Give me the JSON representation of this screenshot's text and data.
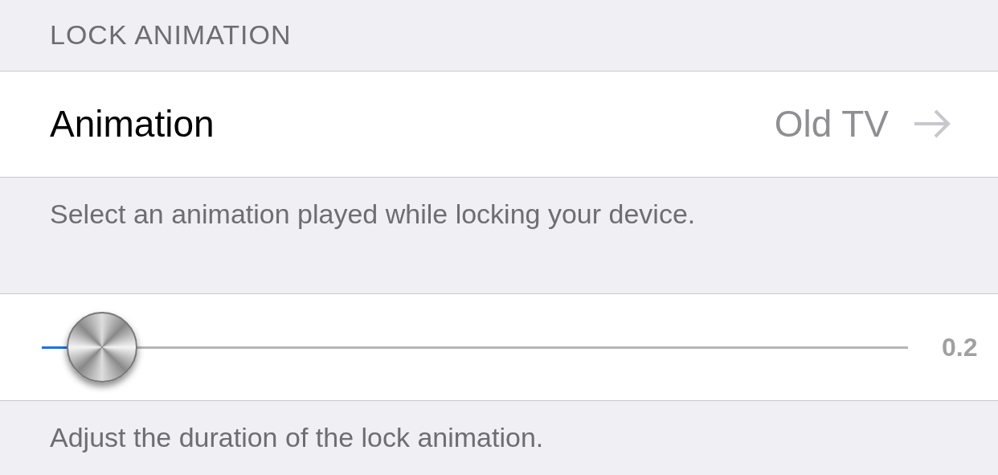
{
  "section_header": "LOCK ANIMATION",
  "animation_row": {
    "label": "Animation",
    "value": "Old TV"
  },
  "animation_footer": "Select an animation played while locking your device.",
  "duration_slider": {
    "level": 0.07,
    "reading": "0.2"
  },
  "duration_footer": "Adjust the duration of the lock animation."
}
